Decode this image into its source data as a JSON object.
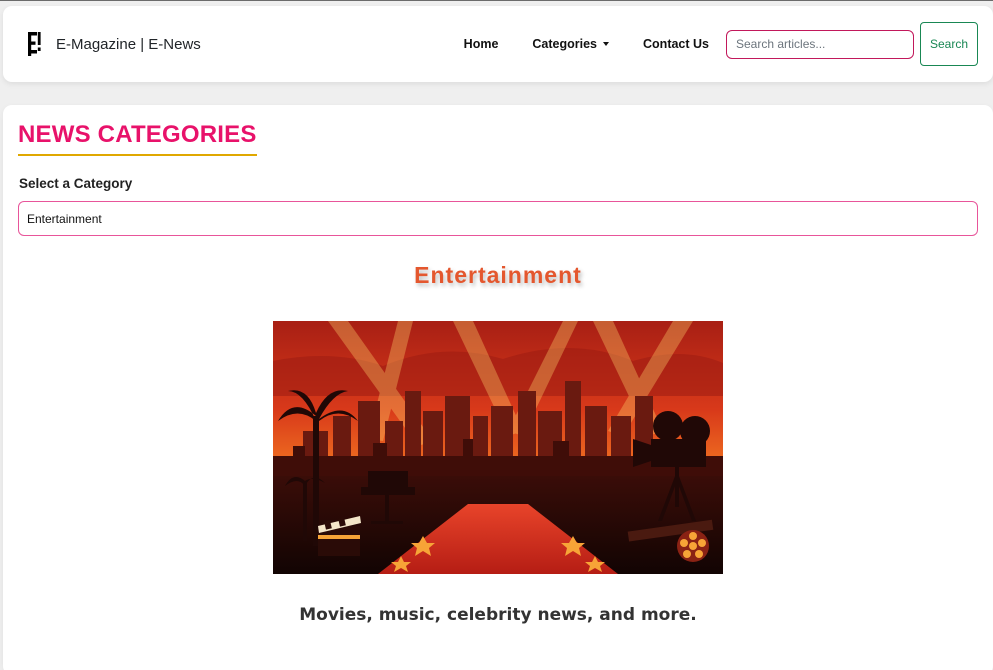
{
  "navbar": {
    "logo_icon": "e-logo-icon",
    "brand": "E-Magazine | E-News",
    "links": [
      {
        "label": "Home"
      },
      {
        "label": "Categories",
        "has_dropdown": true
      },
      {
        "label": "Contact Us"
      }
    ],
    "search": {
      "placeholder": "Search articles...",
      "value": "",
      "button_label": "Search"
    }
  },
  "main": {
    "title": "NEWS CATEGORIES",
    "select_label": "Select a Category",
    "selected_category": "Entertainment",
    "category": {
      "heading": "Entertainment",
      "image_icon": "hollywood-red-carpet-illustration",
      "description": "Movies, music, celebrity news, and more."
    }
  },
  "colors": {
    "accent_pink": "#e8126a",
    "heading_orange": "#e4572e",
    "underline_gold": "#e0a800",
    "search_green": "#198754"
  }
}
